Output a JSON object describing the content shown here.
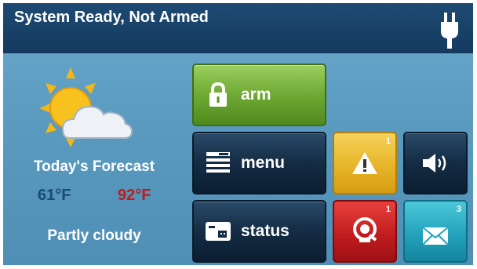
{
  "header": {
    "status_text": "System Ready, Not Armed",
    "power_icon": "power-plug-icon"
  },
  "weather": {
    "icon": "partly-cloudy-icon",
    "title": "Today's Forecast",
    "low": "61°F",
    "high": "92°F",
    "condition": "Partly cloudy"
  },
  "buttons": {
    "arm": {
      "label": "arm",
      "icon": "padlock-icon"
    },
    "menu": {
      "label": "menu",
      "icon": "menu-list-icon"
    },
    "status": {
      "label": "status",
      "icon": "status-panel-icon"
    }
  },
  "tiles": {
    "alert": {
      "icon": "warning-icon",
      "count": "1"
    },
    "volume": {
      "icon": "speaker-volume-icon"
    },
    "trouble": {
      "icon": "bell-icon",
      "count": "1"
    },
    "messages": {
      "icon": "envelope-icon",
      "count": "3"
    }
  },
  "colors": {
    "arm_green": "#6fa934",
    "alert_yellow": "#e8b72c",
    "trouble_red": "#c21d1f",
    "message_teal": "#23a3bd",
    "header_blue": "#143a5e"
  }
}
